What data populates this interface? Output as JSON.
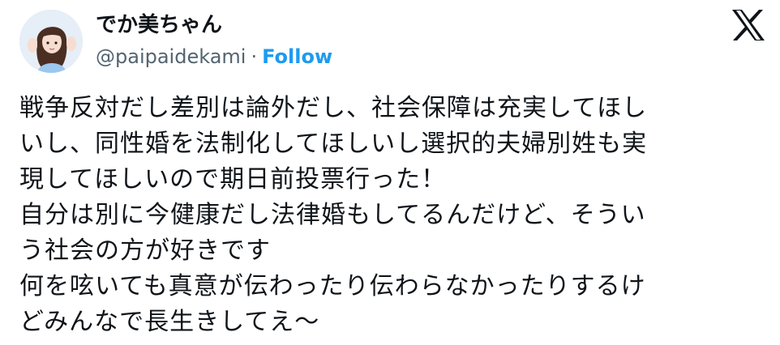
{
  "author": {
    "display_name": "でか美ちゃん",
    "handle": "@paipaidekami",
    "separator": "·",
    "follow_label": "Follow",
    "avatar_icon": "profile-photo"
  },
  "platform": {
    "logo_icon": "x-logo-icon"
  },
  "tweet": {
    "text": "戦争反対だし差別は論外だし、社会保障は充実してほし\nいし、同性婚を法制化してほしいし選択的夫婦別姓も実\n現してほしいので期日前投票行った！\n自分は別に今健康だし法律婚もしてるんだけど、そうい\nう社会の方が好きです\n何を呟いても真意が伝わったり伝わらなかったりするけ\nどみんなで長生きしてえ〜"
  },
  "colors": {
    "text": "#0f1419",
    "secondary": "#536471",
    "link": "#1d9bf0",
    "background": "#ffffff"
  }
}
